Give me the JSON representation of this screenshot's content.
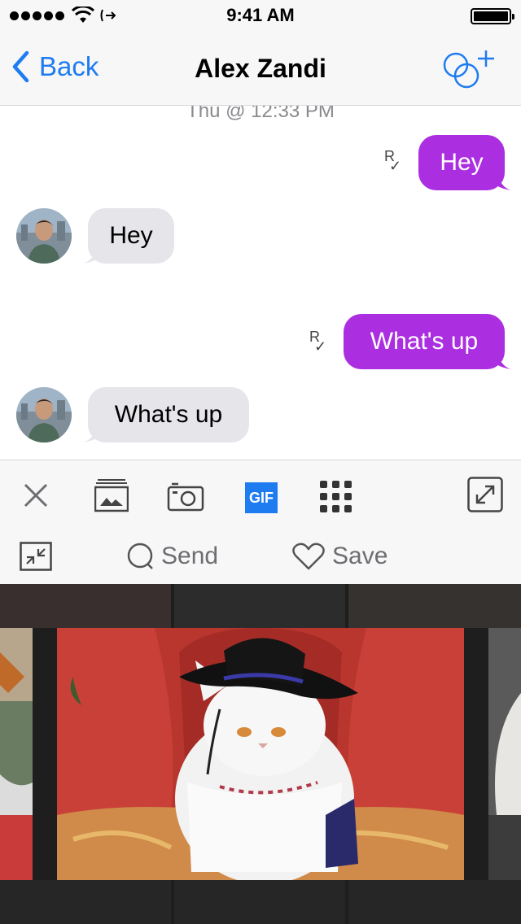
{
  "status_bar": {
    "time": "9:41 AM"
  },
  "nav": {
    "back_label": "Back",
    "title": "Alex Zandi"
  },
  "conversation": {
    "timestamp": "Thu @ 12:33 PM",
    "messages": [
      {
        "direction": "out",
        "text": "Hey"
      },
      {
        "direction": "in",
        "text": "Hey"
      },
      {
        "direction": "out",
        "text": "What's up"
      },
      {
        "direction": "in",
        "text": "What's up"
      }
    ],
    "read_receipt_symbol": "R"
  },
  "composer": {
    "gif_label": "GIF",
    "send_label": "Send",
    "save_label": "Save"
  },
  "colors": {
    "accent": "#1e7cf0",
    "outgoing_bubble": "#ab2fe0",
    "incoming_bubble": "#e5e5ea"
  }
}
